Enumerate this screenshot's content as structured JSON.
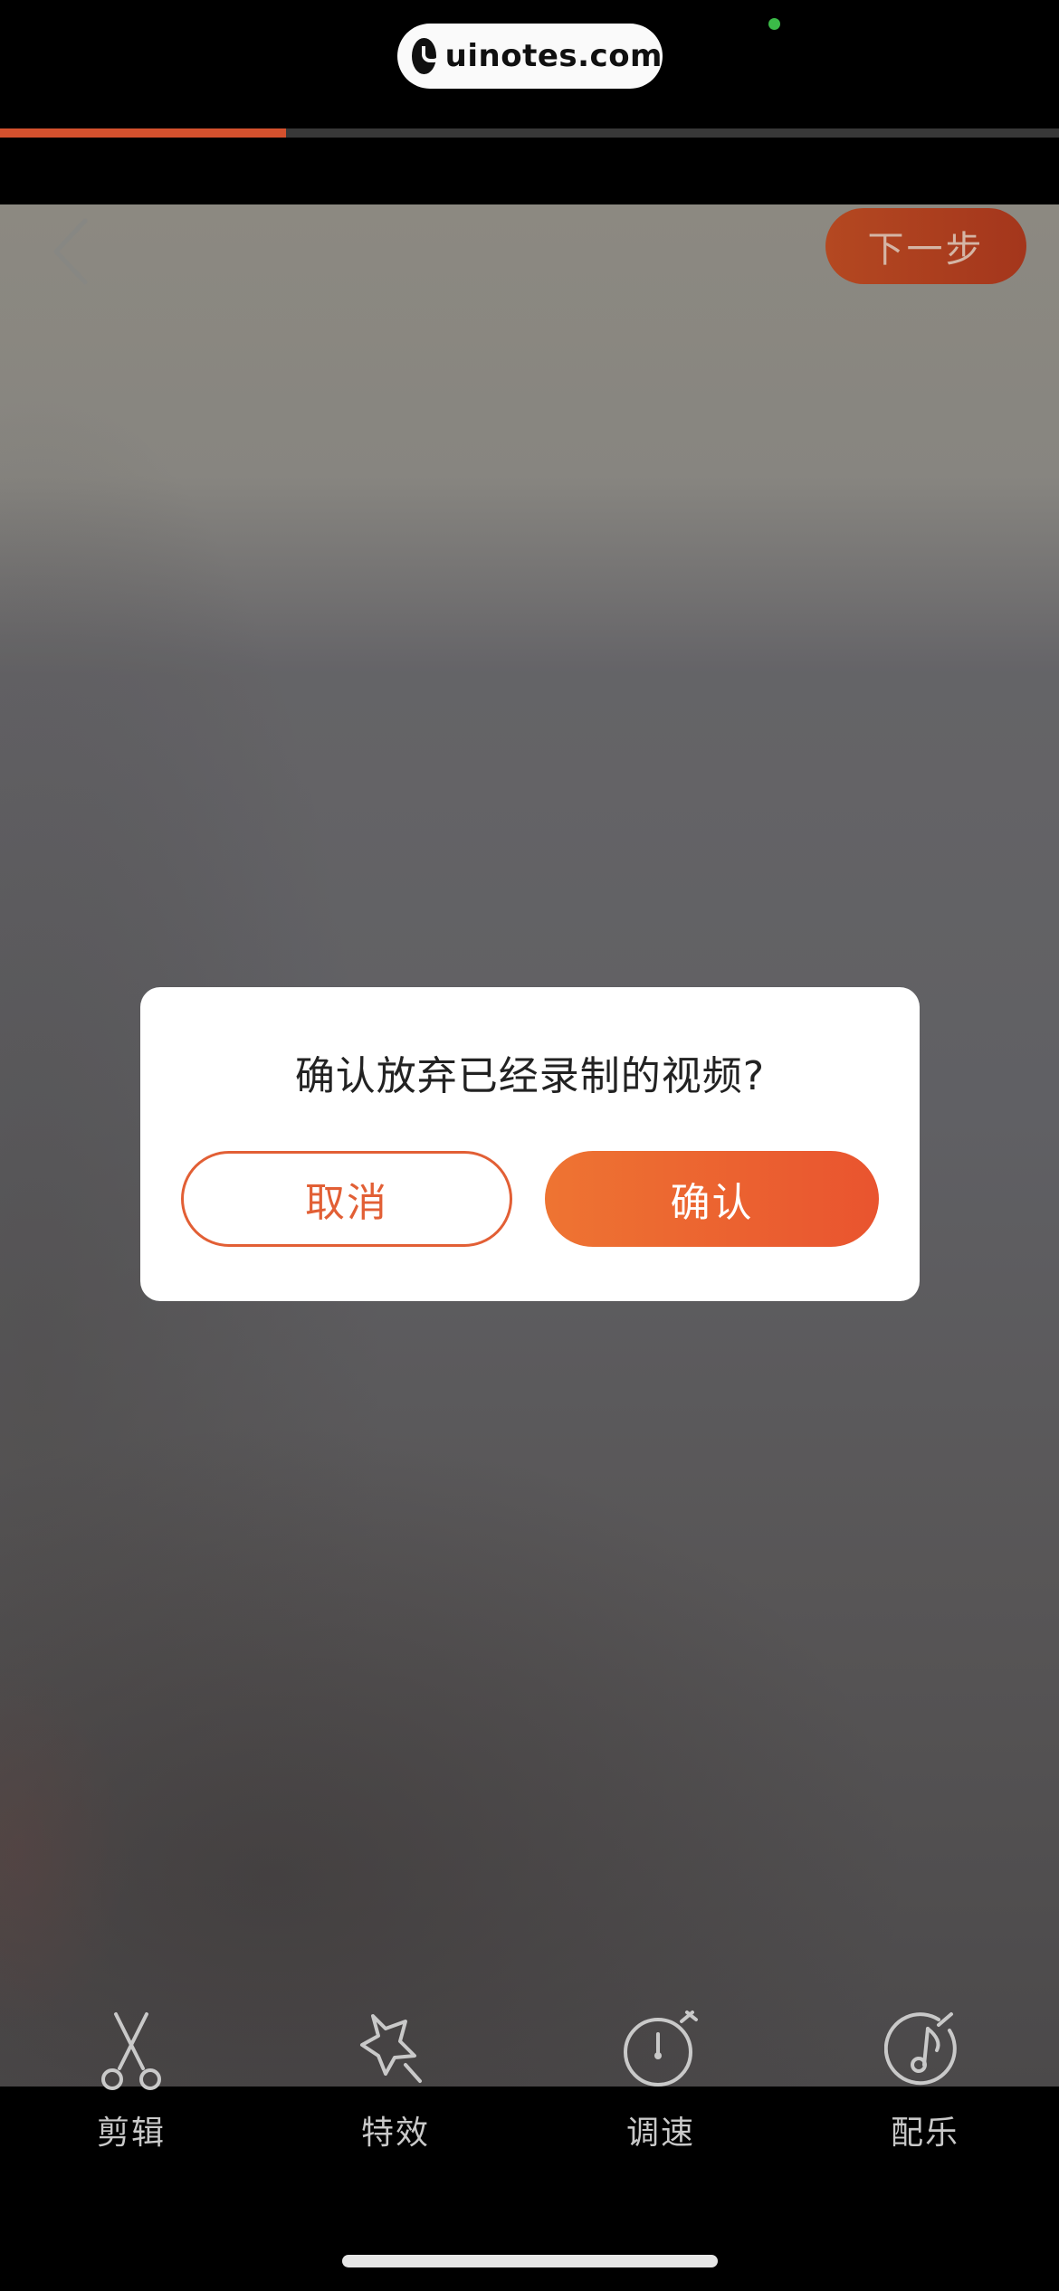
{
  "watermark": {
    "text": "uinotes.com"
  },
  "recording_progress": 0.27,
  "header": {
    "back_icon": "chevron-left-icon",
    "next_label": "下一步"
  },
  "dialog": {
    "message": "确认放弃已经录制的视频?",
    "cancel_label": "取消",
    "confirm_label": "确认"
  },
  "toolbar": {
    "items": [
      {
        "label": "剪辑",
        "icon": "scissors-icon"
      },
      {
        "label": "特效",
        "icon": "magic-wand-icon"
      },
      {
        "label": "调速",
        "icon": "stopwatch-icon"
      },
      {
        "label": "配乐",
        "icon": "music-note-icon"
      }
    ]
  },
  "colors": {
    "accent": "#e9542f",
    "accent_start": "#ee7432",
    "mic_indicator": "#3dbf4a"
  }
}
